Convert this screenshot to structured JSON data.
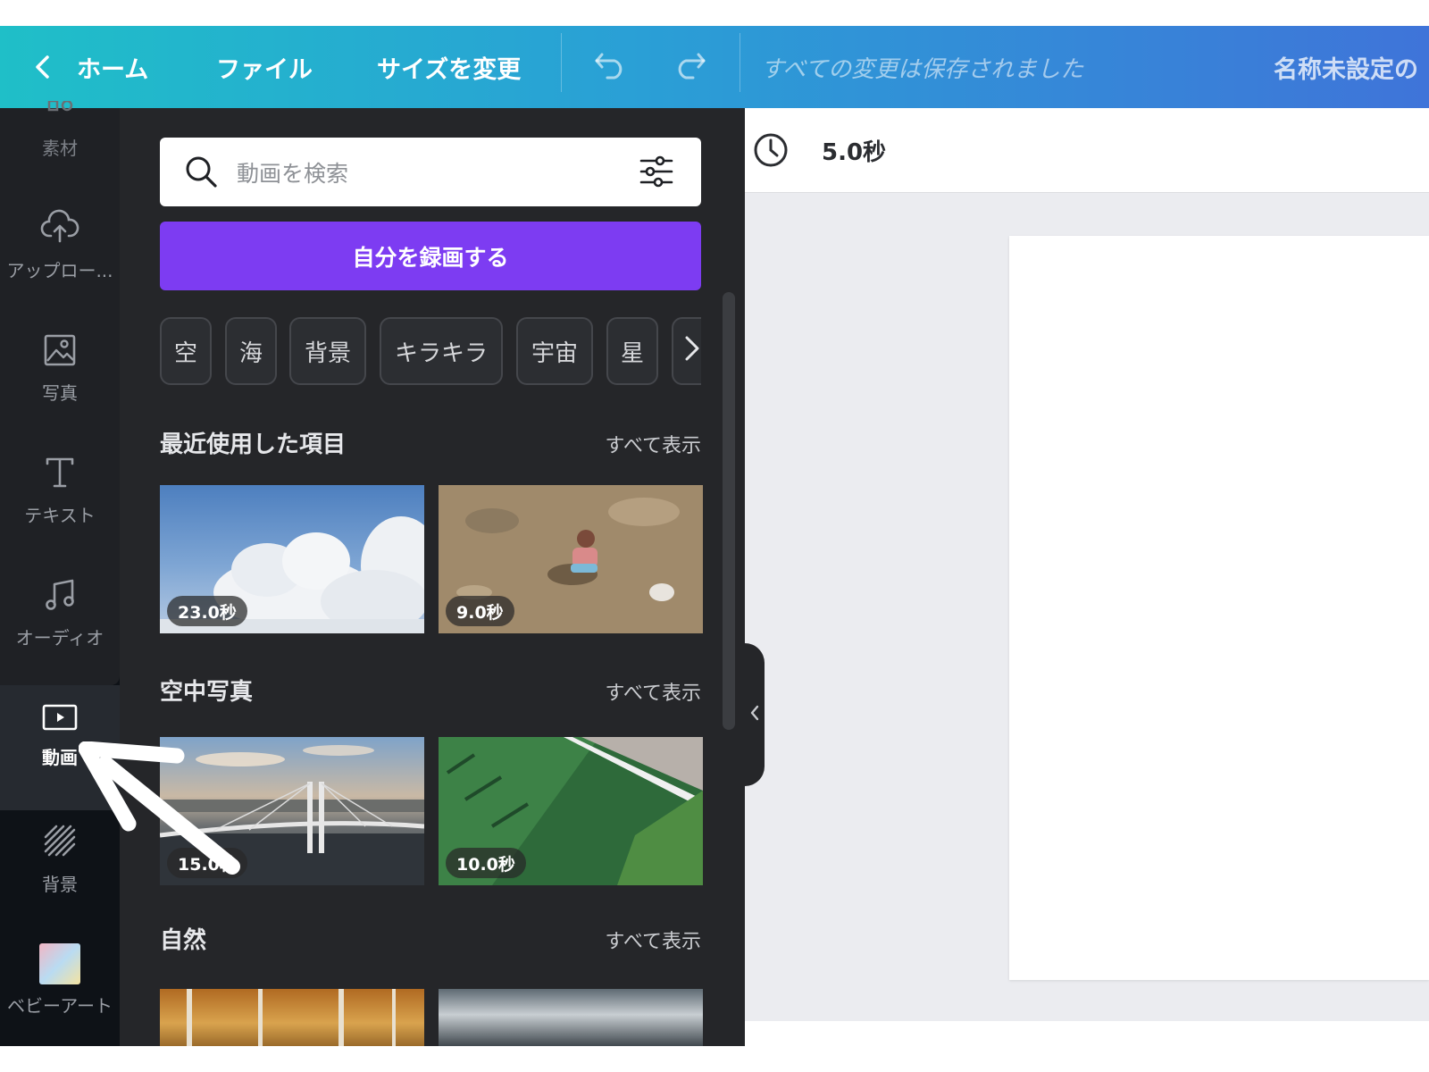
{
  "topbar": {
    "home_label": "ホーム",
    "file_label": "ファイル",
    "resize_label": "サイズを変更",
    "save_status": "すべての変更は保存されました",
    "doc_title": "名称未設定の"
  },
  "rail": {
    "items": [
      {
        "label": "素材",
        "icon": "elements-icon"
      },
      {
        "label": "アップロー...",
        "icon": "cloud-upload-icon"
      },
      {
        "label": "写真",
        "icon": "photo-icon"
      },
      {
        "label": "テキスト",
        "icon": "text-icon"
      },
      {
        "label": "オーディオ",
        "icon": "music-note-icon"
      },
      {
        "label": "動画",
        "icon": "video-icon"
      },
      {
        "label": "背景",
        "icon": "background-icon"
      },
      {
        "label": "ベビーアート",
        "icon": "baby-art-icon"
      }
    ]
  },
  "panel": {
    "search_placeholder": "動画を検索",
    "record_label": "自分を録画する",
    "chips": [
      "空",
      "海",
      "背景",
      "キラキラ",
      "宇宙",
      "星"
    ],
    "sections": [
      {
        "title": "最近使用した項目",
        "link": "すべて表示",
        "items": [
          {
            "duration": "23.0秒"
          },
          {
            "duration": "9.0秒"
          }
        ]
      },
      {
        "title": "空中写真",
        "link": "すべて表示",
        "items": [
          {
            "duration": "15.0秒"
          },
          {
            "duration": "10.0秒"
          }
        ]
      },
      {
        "title": "自然",
        "link": "すべて表示",
        "items": [
          {
            "duration": ""
          },
          {
            "duration": ""
          }
        ]
      }
    ]
  },
  "canvas": {
    "duration": "5.0秒"
  },
  "colors": {
    "accent_purple": "#7d3cf2",
    "topbar_start": "#1fbfc8",
    "topbar_end": "#3f74d9",
    "panel_bg": "#252629"
  }
}
